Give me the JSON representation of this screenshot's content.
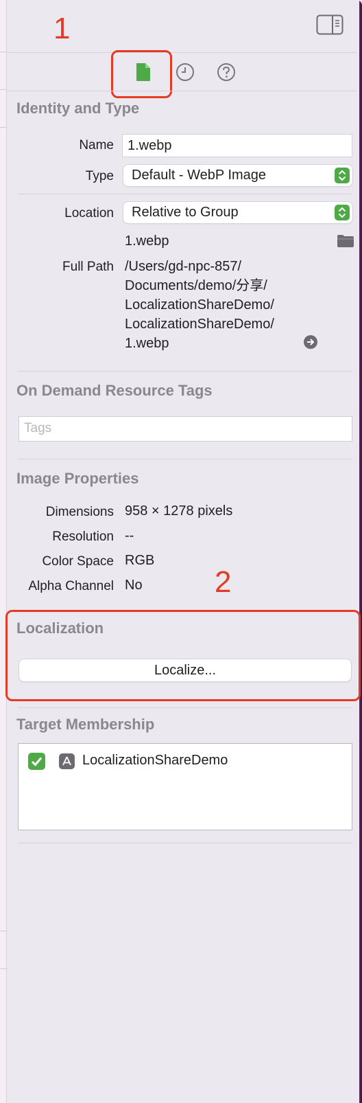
{
  "annotations": {
    "marker_1": "1",
    "marker_2": "2"
  },
  "toolbar": {
    "tabs": [
      {
        "name": "file-inspector",
        "icon": "file-icon",
        "selected": true
      },
      {
        "name": "history-inspector",
        "icon": "clock-icon",
        "selected": false
      },
      {
        "name": "quick-help",
        "icon": "question-icon",
        "selected": false
      }
    ]
  },
  "identity": {
    "title": "Identity and Type",
    "name_label": "Name",
    "name_value": "1.webp",
    "type_label": "Type",
    "type_value": "Default - WebP Image",
    "location_label": "Location",
    "location_value": "Relative to Group",
    "location_file": "1.webp",
    "full_path_label": "Full Path",
    "full_path_lines": [
      "/Users/gd-npc-857/",
      "Documents/demo/分享/",
      "LocalizationShareDemo/",
      "LocalizationShareDemo/",
      "1.webp"
    ]
  },
  "on_demand": {
    "title": "On Demand Resource Tags",
    "tags_placeholder": "Tags"
  },
  "image_properties": {
    "title": "Image Properties",
    "dimensions_label": "Dimensions",
    "dimensions_value": "958 × 1278 pixels",
    "resolution_label": "Resolution",
    "resolution_value": "--",
    "color_space_label": "Color Space",
    "color_space_value": "RGB",
    "alpha_label": "Alpha Channel",
    "alpha_value": "No"
  },
  "localization": {
    "title": "Localization",
    "button_label": "Localize..."
  },
  "target_membership": {
    "title": "Target Membership",
    "items": [
      {
        "name": "LocalizationShareDemo",
        "checked": true,
        "icon": "app-target-icon"
      }
    ]
  },
  "colors": {
    "accent_green": "#4daa47",
    "annotation_red": "#e43b26"
  }
}
